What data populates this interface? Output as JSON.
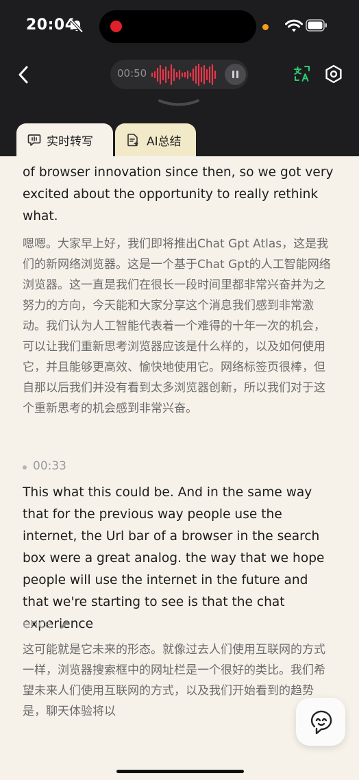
{
  "status_bar": {
    "time": "20:04"
  },
  "header": {
    "recording_time": "00:50"
  },
  "tabs": [
    {
      "label": "实时转写",
      "active": true
    },
    {
      "label": "AI总结",
      "active": false
    }
  ],
  "transcript": {
    "para1_en": "of browser innovation since then, so we got very excited about the opportunity to really rethink what.",
    "para1_zh": "嗯嗯。大家早上好，我们即将推出Chat Gpt Atlas，这是我们的新网络浏览器。这是一个基于Chat Gpt的人工智能网络浏览器。这一直是我们在很长一段时间里都非常兴奋并为之努力的方向，今天能和大家分享这个消息我们感到非常激动。我们认为人工智能代表着一个难得的十年一次的机会，可以让我们重新思考浏览器应该是什么样的，以及如何使用它，并且能够更高效、愉快地使用它。网络标签页很棒，但自那以后我们并没有看到太多浏览器创新，所以我们对于这个重新思考的机会感到非常兴奋。",
    "segment2_timestamp": "00:33",
    "para2_en": "This what this could be. And in the same way that for the previous way people use the internet, the Url bar of a browser in the search box were a great analog. the way that we hope people will use the internet in the future and that we're starting to see is that the chat experience",
    "para2_partial": "ence",
    "para2_zh": "这可能就是它未来的形态。就像过去人们使用互联网的方式一样，浏览器搜索框中的网址栏是一个很好的类比。我们希望未来人们使用互联网的方式，以及我们开始看到的趋势是，聊天体验将以"
  },
  "colors": {
    "header_bg": "#1d1d1f",
    "record_red": "#e0212a",
    "translate_green": "#2ecc71",
    "content_bg": "#f6f2ea",
    "inactive_tab_bg": "#f1e9c8"
  },
  "icons": [
    "mute-icon",
    "wifi-icon",
    "battery-icon",
    "back-arrow-icon",
    "waveform-icon",
    "pause-icon",
    "translate-icon",
    "settings-icon",
    "transcript-icon",
    "ai-summary-icon",
    "edit-pencil-icon",
    "assistant-icon"
  ]
}
